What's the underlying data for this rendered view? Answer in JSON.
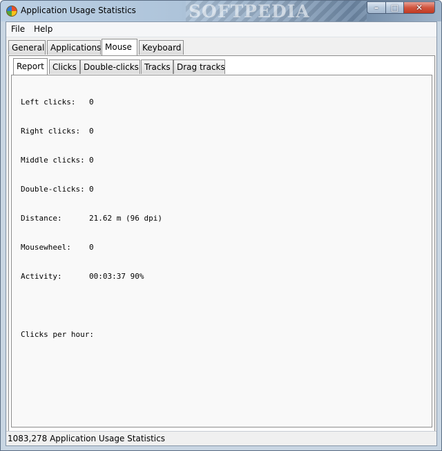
{
  "window": {
    "title": "Application Usage Statistics",
    "watermark": "SOFTPEDIA",
    "controls": {
      "minimize": "–",
      "maximize": "□",
      "close": "✕"
    }
  },
  "menu": {
    "file": "File",
    "help": "Help"
  },
  "tabs": [
    "General",
    "Applications",
    "Mouse",
    "Keyboard"
  ],
  "subtabs": [
    "Report",
    "Clicks",
    "Double-clicks",
    "Tracks",
    "Drag tracks"
  ],
  "report": [
    {
      "label": "Left clicks:",
      "value": "0"
    },
    {
      "label": "Right clicks:",
      "value": "0"
    },
    {
      "label": "Middle clicks:",
      "value": "0"
    },
    {
      "label": "Double-clicks:",
      "value": "0"
    },
    {
      "label": "Distance:",
      "value": "21.62 m (96 dpi)"
    },
    {
      "label": "Mousewheel:",
      "value": "0"
    },
    {
      "label": "Activity:",
      "value": "00:03:37 90%"
    }
  ],
  "clicks_per_hour_label": "Clicks per hour:",
  "status": "1083,278  Application Usage Statistics",
  "colors": {
    "titlebar": "#aec4da",
    "close": "#c03a22",
    "panel": "#f9f9f9"
  }
}
